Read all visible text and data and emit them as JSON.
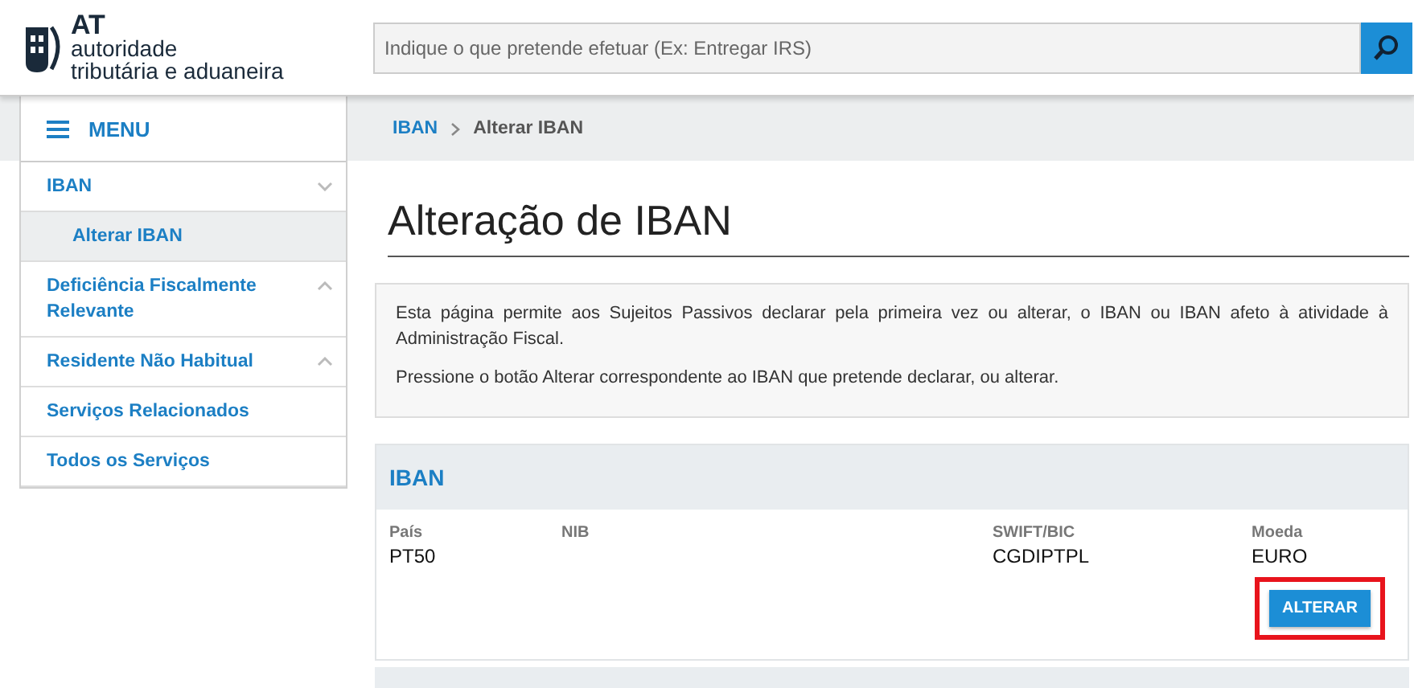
{
  "header": {
    "logo": {
      "abbr": "AT",
      "line1": "autoridade",
      "line2": "tributária e aduaneira"
    },
    "search": {
      "placeholder": "Indique o que pretende efetuar (Ex: Entregar IRS)"
    }
  },
  "menu": {
    "title": "MENU",
    "items": [
      {
        "label": "IBAN",
        "expanded": true,
        "children": [
          {
            "label": "Alterar IBAN",
            "selected": true
          }
        ]
      },
      {
        "label": "Deficiência Fiscalmente Relevante",
        "expanded": false
      },
      {
        "label": "Residente Não Habitual",
        "expanded": false
      },
      {
        "label": "Serviços Relacionados"
      },
      {
        "label": "Todos os Serviços"
      }
    ]
  },
  "breadcrumb": [
    {
      "label": "IBAN"
    },
    {
      "label": "Alterar IBAN"
    }
  ],
  "page_title": "Alteração de IBAN",
  "info": [
    "Esta página permite aos Sujeitos Passivos declarar pela primeira vez ou alterar, o IBAN ou IBAN afeto à atividade à Administração Fiscal.",
    "Pressione o botão Alterar correspondente ao IBAN que pretende declarar, ou alterar."
  ],
  "iban_card": {
    "title": "IBAN",
    "fields": [
      {
        "label": "País",
        "value": "PT50"
      },
      {
        "label": "NIB"
      },
      {
        "label": "SWIFT/BIC",
        "value": "CGDIPTPL"
      },
      {
        "label": "Moeda",
        "value": "EURO"
      }
    ],
    "button": {
      "label": "ALTERAR",
      "highlighted": true
    }
  }
}
